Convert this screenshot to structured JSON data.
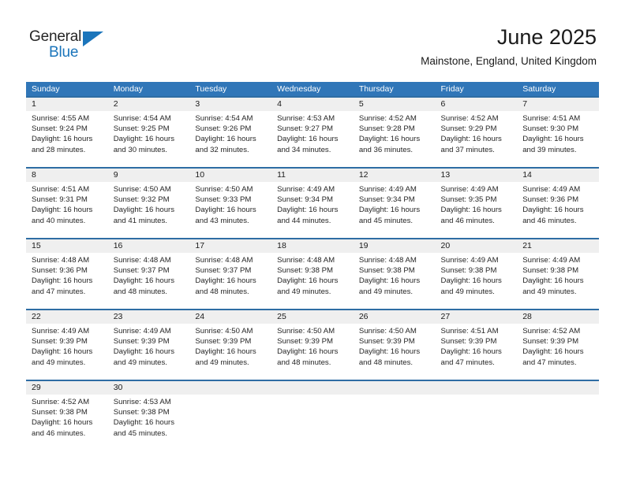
{
  "brand": {
    "name_part1": "General",
    "name_part2": "Blue",
    "triangle_icon": "triangle-icon",
    "color_blue": "#1b75bb",
    "color_dark": "#262626"
  },
  "header": {
    "month_title": "June 2025",
    "location": "Mainstone, England, United Kingdom"
  },
  "theme": {
    "header_blue": "#3076b8",
    "row_divider_blue": "#2e6da4",
    "daynum_band": "#efefef",
    "text": "#1a1a1a"
  },
  "calendar": {
    "weekday_headers": [
      "Sunday",
      "Monday",
      "Tuesday",
      "Wednesday",
      "Thursday",
      "Friday",
      "Saturday"
    ],
    "weeks": [
      {
        "daynums": [
          "1",
          "2",
          "3",
          "4",
          "5",
          "6",
          "7"
        ],
        "cells": [
          {
            "sunrise": "Sunrise: 4:55 AM",
            "sunset": "Sunset: 9:24 PM",
            "daylight1": "Daylight: 16 hours",
            "daylight2": "and 28 minutes."
          },
          {
            "sunrise": "Sunrise: 4:54 AM",
            "sunset": "Sunset: 9:25 PM",
            "daylight1": "Daylight: 16 hours",
            "daylight2": "and 30 minutes."
          },
          {
            "sunrise": "Sunrise: 4:54 AM",
            "sunset": "Sunset: 9:26 PM",
            "daylight1": "Daylight: 16 hours",
            "daylight2": "and 32 minutes."
          },
          {
            "sunrise": "Sunrise: 4:53 AM",
            "sunset": "Sunset: 9:27 PM",
            "daylight1": "Daylight: 16 hours",
            "daylight2": "and 34 minutes."
          },
          {
            "sunrise": "Sunrise: 4:52 AM",
            "sunset": "Sunset: 9:28 PM",
            "daylight1": "Daylight: 16 hours",
            "daylight2": "and 36 minutes."
          },
          {
            "sunrise": "Sunrise: 4:52 AM",
            "sunset": "Sunset: 9:29 PM",
            "daylight1": "Daylight: 16 hours",
            "daylight2": "and 37 minutes."
          },
          {
            "sunrise": "Sunrise: 4:51 AM",
            "sunset": "Sunset: 9:30 PM",
            "daylight1": "Daylight: 16 hours",
            "daylight2": "and 39 minutes."
          }
        ]
      },
      {
        "daynums": [
          "8",
          "9",
          "10",
          "11",
          "12",
          "13",
          "14"
        ],
        "cells": [
          {
            "sunrise": "Sunrise: 4:51 AM",
            "sunset": "Sunset: 9:31 PM",
            "daylight1": "Daylight: 16 hours",
            "daylight2": "and 40 minutes."
          },
          {
            "sunrise": "Sunrise: 4:50 AM",
            "sunset": "Sunset: 9:32 PM",
            "daylight1": "Daylight: 16 hours",
            "daylight2": "and 41 minutes."
          },
          {
            "sunrise": "Sunrise: 4:50 AM",
            "sunset": "Sunset: 9:33 PM",
            "daylight1": "Daylight: 16 hours",
            "daylight2": "and 43 minutes."
          },
          {
            "sunrise": "Sunrise: 4:49 AM",
            "sunset": "Sunset: 9:34 PM",
            "daylight1": "Daylight: 16 hours",
            "daylight2": "and 44 minutes."
          },
          {
            "sunrise": "Sunrise: 4:49 AM",
            "sunset": "Sunset: 9:34 PM",
            "daylight1": "Daylight: 16 hours",
            "daylight2": "and 45 minutes."
          },
          {
            "sunrise": "Sunrise: 4:49 AM",
            "sunset": "Sunset: 9:35 PM",
            "daylight1": "Daylight: 16 hours",
            "daylight2": "and 46 minutes."
          },
          {
            "sunrise": "Sunrise: 4:49 AM",
            "sunset": "Sunset: 9:36 PM",
            "daylight1": "Daylight: 16 hours",
            "daylight2": "and 46 minutes."
          }
        ]
      },
      {
        "daynums": [
          "15",
          "16",
          "17",
          "18",
          "19",
          "20",
          "21"
        ],
        "cells": [
          {
            "sunrise": "Sunrise: 4:48 AM",
            "sunset": "Sunset: 9:36 PM",
            "daylight1": "Daylight: 16 hours",
            "daylight2": "and 47 minutes."
          },
          {
            "sunrise": "Sunrise: 4:48 AM",
            "sunset": "Sunset: 9:37 PM",
            "daylight1": "Daylight: 16 hours",
            "daylight2": "and 48 minutes."
          },
          {
            "sunrise": "Sunrise: 4:48 AM",
            "sunset": "Sunset: 9:37 PM",
            "daylight1": "Daylight: 16 hours",
            "daylight2": "and 48 minutes."
          },
          {
            "sunrise": "Sunrise: 4:48 AM",
            "sunset": "Sunset: 9:38 PM",
            "daylight1": "Daylight: 16 hours",
            "daylight2": "and 49 minutes."
          },
          {
            "sunrise": "Sunrise: 4:48 AM",
            "sunset": "Sunset: 9:38 PM",
            "daylight1": "Daylight: 16 hours",
            "daylight2": "and 49 minutes."
          },
          {
            "sunrise": "Sunrise: 4:49 AM",
            "sunset": "Sunset: 9:38 PM",
            "daylight1": "Daylight: 16 hours",
            "daylight2": "and 49 minutes."
          },
          {
            "sunrise": "Sunrise: 4:49 AM",
            "sunset": "Sunset: 9:38 PM",
            "daylight1": "Daylight: 16 hours",
            "daylight2": "and 49 minutes."
          }
        ]
      },
      {
        "daynums": [
          "22",
          "23",
          "24",
          "25",
          "26",
          "27",
          "28"
        ],
        "cells": [
          {
            "sunrise": "Sunrise: 4:49 AM",
            "sunset": "Sunset: 9:39 PM",
            "daylight1": "Daylight: 16 hours",
            "daylight2": "and 49 minutes."
          },
          {
            "sunrise": "Sunrise: 4:49 AM",
            "sunset": "Sunset: 9:39 PM",
            "daylight1": "Daylight: 16 hours",
            "daylight2": "and 49 minutes."
          },
          {
            "sunrise": "Sunrise: 4:50 AM",
            "sunset": "Sunset: 9:39 PM",
            "daylight1": "Daylight: 16 hours",
            "daylight2": "and 49 minutes."
          },
          {
            "sunrise": "Sunrise: 4:50 AM",
            "sunset": "Sunset: 9:39 PM",
            "daylight1": "Daylight: 16 hours",
            "daylight2": "and 48 minutes."
          },
          {
            "sunrise": "Sunrise: 4:50 AM",
            "sunset": "Sunset: 9:39 PM",
            "daylight1": "Daylight: 16 hours",
            "daylight2": "and 48 minutes."
          },
          {
            "sunrise": "Sunrise: 4:51 AM",
            "sunset": "Sunset: 9:39 PM",
            "daylight1": "Daylight: 16 hours",
            "daylight2": "and 47 minutes."
          },
          {
            "sunrise": "Sunrise: 4:52 AM",
            "sunset": "Sunset: 9:39 PM",
            "daylight1": "Daylight: 16 hours",
            "daylight2": "and 47 minutes."
          }
        ]
      },
      {
        "daynums": [
          "29",
          "30",
          "",
          "",
          "",
          "",
          ""
        ],
        "cells": [
          {
            "sunrise": "Sunrise: 4:52 AM",
            "sunset": "Sunset: 9:38 PM",
            "daylight1": "Daylight: 16 hours",
            "daylight2": "and 46 minutes."
          },
          {
            "sunrise": "Sunrise: 4:53 AM",
            "sunset": "Sunset: 9:38 PM",
            "daylight1": "Daylight: 16 hours",
            "daylight2": "and 45 minutes."
          },
          {
            "sunrise": "",
            "sunset": "",
            "daylight1": "",
            "daylight2": ""
          },
          {
            "sunrise": "",
            "sunset": "",
            "daylight1": "",
            "daylight2": ""
          },
          {
            "sunrise": "",
            "sunset": "",
            "daylight1": "",
            "daylight2": ""
          },
          {
            "sunrise": "",
            "sunset": "",
            "daylight1": "",
            "daylight2": ""
          },
          {
            "sunrise": "",
            "sunset": "",
            "daylight1": "",
            "daylight2": ""
          }
        ]
      }
    ]
  }
}
